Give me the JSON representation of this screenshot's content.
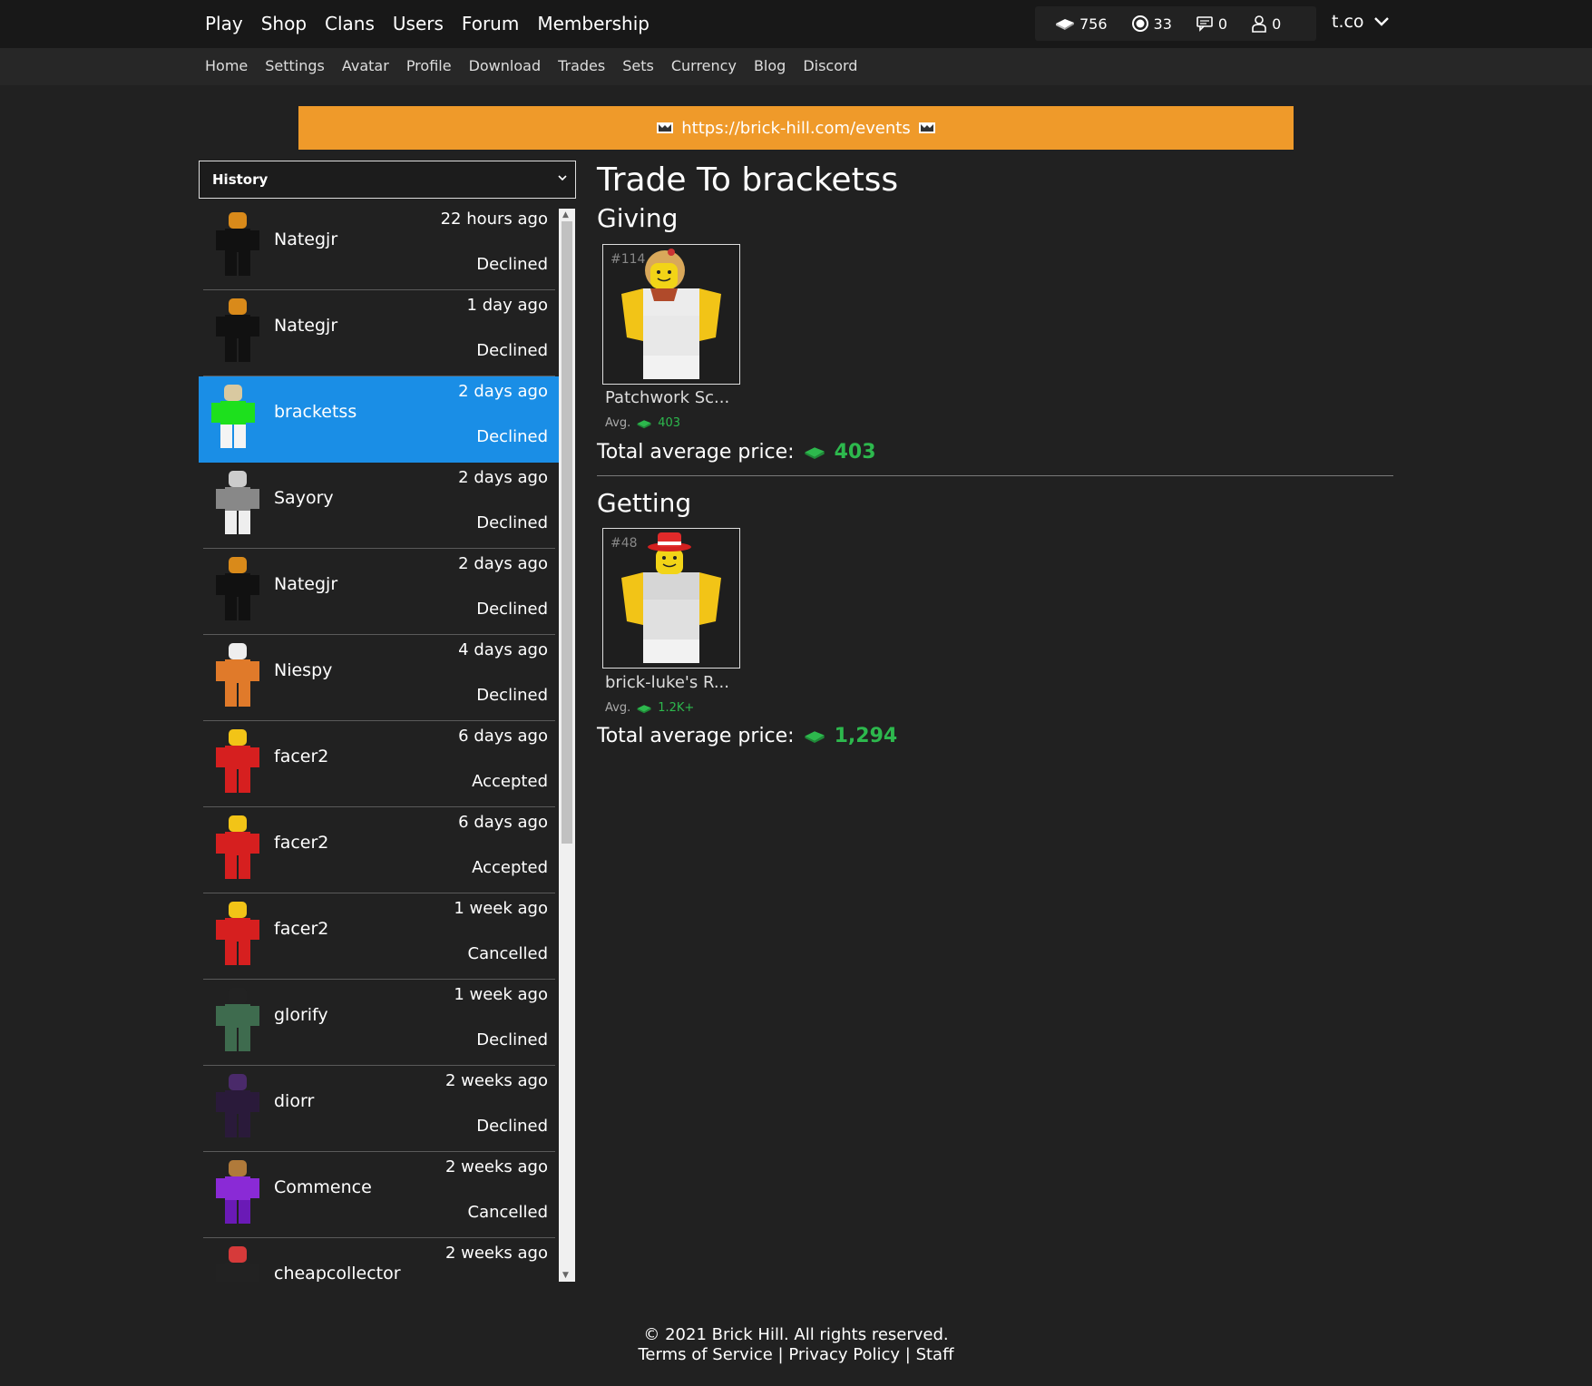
{
  "nav": {
    "main": [
      "Play",
      "Shop",
      "Clans",
      "Users",
      "Forum",
      "Membership"
    ],
    "stats": {
      "bucks": "756",
      "bits": "33",
      "messages": "0",
      "friends": "0"
    },
    "username": "t.co",
    "sub": [
      "Home",
      "Settings",
      "Avatar",
      "Profile",
      "Download",
      "Trades",
      "Sets",
      "Currency",
      "Blog",
      "Discord"
    ]
  },
  "banner": {
    "link": "https://brick-hill.com/events",
    "color": "#ef9a2a"
  },
  "history": {
    "select_value": "History",
    "items": [
      {
        "user": "Nategjr",
        "time": "22 hours ago",
        "status": "Declined",
        "avatar": "nategjr-avatar",
        "active": false
      },
      {
        "user": "Nategjr",
        "time": "1 day ago",
        "status": "Declined",
        "avatar": "nategjr-avatar",
        "active": false
      },
      {
        "user": "bracketss",
        "time": "2 days ago",
        "status": "Declined",
        "avatar": "bracketss-avatar",
        "active": true
      },
      {
        "user": "Sayory",
        "time": "2 days ago",
        "status": "Declined",
        "avatar": "sayory-avatar",
        "active": false
      },
      {
        "user": "Nategjr",
        "time": "2 days ago",
        "status": "Declined",
        "avatar": "nategjr-avatar",
        "active": false
      },
      {
        "user": "Niespy",
        "time": "4 days ago",
        "status": "Declined",
        "avatar": "niespy-avatar",
        "active": false
      },
      {
        "user": "facer2",
        "time": "6 days ago",
        "status": "Accepted",
        "avatar": "facer2-avatar",
        "active": false
      },
      {
        "user": "facer2",
        "time": "6 days ago",
        "status": "Accepted",
        "avatar": "facer2-avatar",
        "active": false
      },
      {
        "user": "facer2",
        "time": "1 week ago",
        "status": "Cancelled",
        "avatar": "facer2-avatar",
        "active": false
      },
      {
        "user": "glorify",
        "time": "1 week ago",
        "status": "Declined",
        "avatar": "glorify-avatar",
        "active": false
      },
      {
        "user": "diorr",
        "time": "2 weeks ago",
        "status": "Declined",
        "avatar": "diorr-avatar",
        "active": false
      },
      {
        "user": "Commence",
        "time": "2 weeks ago",
        "status": "Cancelled",
        "avatar": "commence-avatar",
        "active": false
      },
      {
        "user": "cheapcollector",
        "time": "2 weeks ago",
        "status": "",
        "avatar": "cheapcollector-avatar",
        "active": false
      }
    ]
  },
  "trade": {
    "title": "Trade To bracketss",
    "giving": {
      "heading": "Giving",
      "item": {
        "serial": "#114",
        "name": "Patchwork Sc...",
        "avg_label": "Avg.",
        "avg": "403"
      },
      "total_label": "Total average price:",
      "total": "403"
    },
    "getting": {
      "heading": "Getting",
      "item": {
        "serial": "#48",
        "name": "brick-luke's R...",
        "avg_label": "Avg.",
        "avg": "1.2K+"
      },
      "total_label": "Total average price:",
      "total": "1,294"
    }
  },
  "footer": {
    "copyright": "© 2021 Brick Hill. All rights reserved.",
    "terms": "Terms of Service",
    "privacy": "Privacy Policy",
    "staff": "Staff",
    "separator": "|"
  },
  "colors": {
    "accent_blue": "#1a8ee6",
    "green": "#2db84d",
    "banner": "#ef9a2a"
  }
}
